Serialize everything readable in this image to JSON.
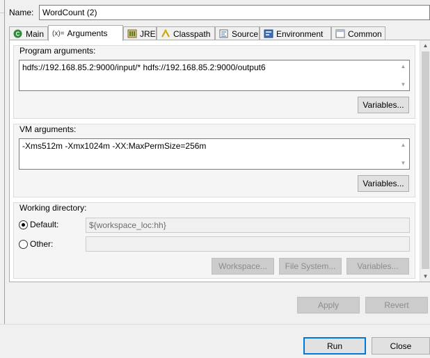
{
  "name": {
    "label": "Name:",
    "value": "WordCount (2)"
  },
  "tabs": [
    {
      "label": "Main",
      "icon": "main-tab-icon"
    },
    {
      "label": "Arguments",
      "icon": "arguments-tab-icon",
      "prefix": "(x)="
    },
    {
      "label": "JRE",
      "icon": "jre-tab-icon"
    },
    {
      "label": "Classpath",
      "icon": "classpath-tab-icon"
    },
    {
      "label": "Source",
      "icon": "source-tab-icon"
    },
    {
      "label": "Environment",
      "icon": "environment-tab-icon"
    },
    {
      "label": "Common",
      "icon": "common-tab-icon"
    }
  ],
  "active_tab": "Arguments",
  "program_arguments": {
    "title": "Program arguments:",
    "value": "hdfs://192.168.85.2:9000/input/* hdfs://192.168.85.2:9000/output6",
    "variables_label": "Variables..."
  },
  "vm_arguments": {
    "title": "VM arguments:",
    "value": "-Xms512m -Xmx1024m -XX:MaxPermSize=256m",
    "variables_label": "Variables..."
  },
  "working_directory": {
    "title": "Working directory:",
    "default_label": "Default:",
    "default_value": "${workspace_loc:hh}",
    "other_label": "Other:",
    "other_value": "",
    "workspace_label": "Workspace...",
    "filesystem_label": "File System...",
    "variables_label": "Variables...",
    "selected": "default"
  },
  "actions": {
    "apply_label": "Apply",
    "revert_label": "Revert"
  },
  "dialog": {
    "run_label": "Run",
    "close_label": "Close"
  },
  "colors": {
    "accent": "#0078d7",
    "panel": "#ffffff",
    "background": "#f0f0f0",
    "group": "#f5f5f5"
  }
}
